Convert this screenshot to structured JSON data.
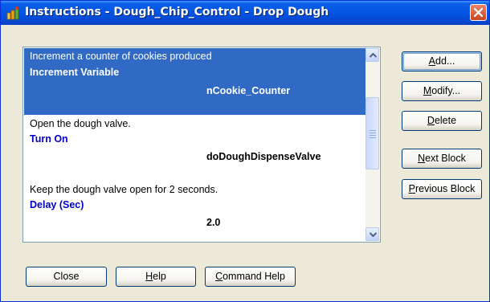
{
  "window": {
    "title": "Instructions - Dough_Chip_Control - Drop Dough"
  },
  "instructions": [
    {
      "comment": "Increment a counter of cookies produced",
      "command": "Increment Variable",
      "argument": "nCookie_Counter",
      "selected": true
    },
    {
      "comment": "Open the dough valve.",
      "command": "Turn On",
      "argument": "doDoughDispenseValve",
      "selected": false
    },
    {
      "comment": "Keep the dough valve open for 2 seconds.",
      "command": "Delay (Sec)",
      "argument": "2.0",
      "selected": false
    }
  ],
  "side_buttons": {
    "add": {
      "pre": "",
      "key": "A",
      "post": "dd..."
    },
    "modify": {
      "pre": "",
      "key": "M",
      "post": "odify..."
    },
    "delete": {
      "pre": "",
      "key": "D",
      "post": "elete"
    },
    "next_block": {
      "pre": "",
      "key": "N",
      "post": "ext Block"
    },
    "previous_block": {
      "pre": "",
      "key": "P",
      "post": "revious Block"
    }
  },
  "bottom_buttons": {
    "close": {
      "label": "Close"
    },
    "help": {
      "pre": "",
      "key": "H",
      "post": "elp"
    },
    "command_help": {
      "pre": "",
      "key": "C",
      "post": "ommand Help"
    }
  },
  "icons": [
    "app-icon",
    "close-icon",
    "scroll-up-icon",
    "scroll-down-icon"
  ],
  "colors": {
    "selection": "#316AC5",
    "command_text": "#0000CC",
    "titlebar": "#0554E3"
  }
}
